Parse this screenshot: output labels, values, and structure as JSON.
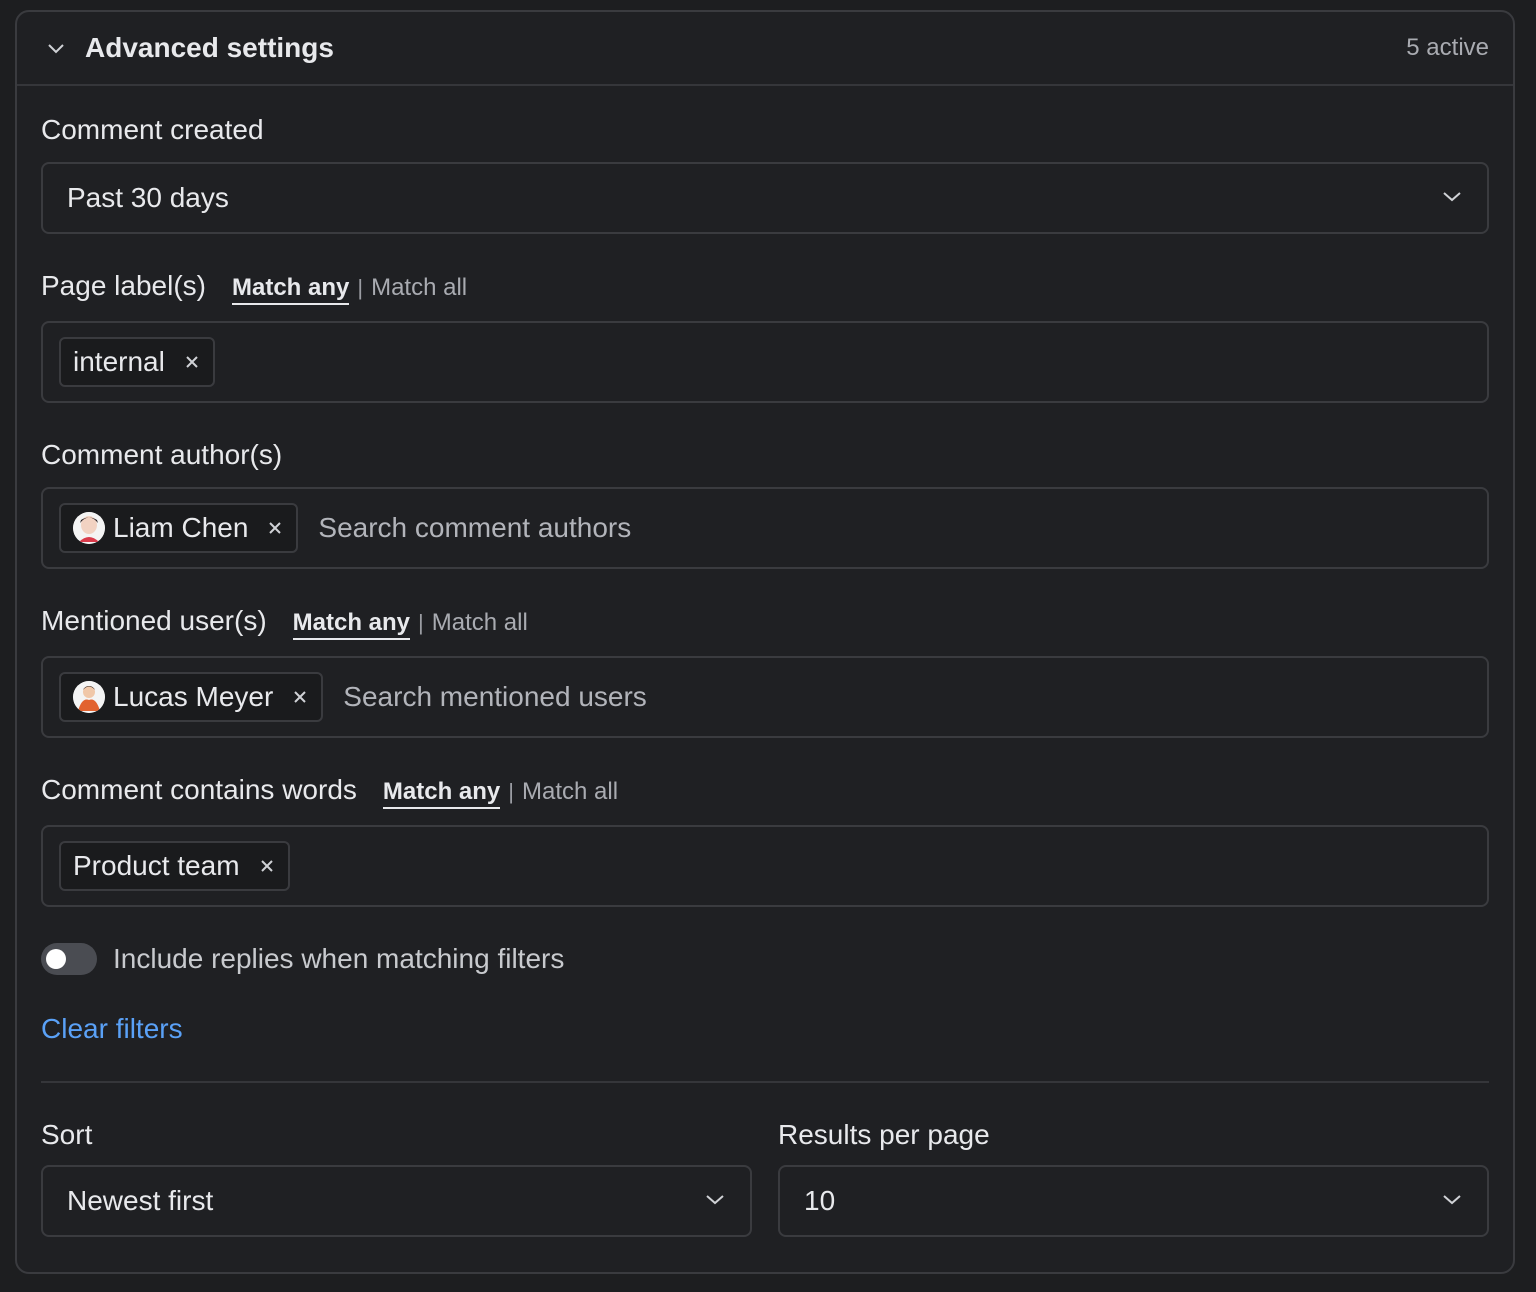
{
  "header": {
    "title": "Advanced settings",
    "active_count": "5 active"
  },
  "comment_created": {
    "label": "Comment created",
    "value": "Past 30 days"
  },
  "page_labels": {
    "label": "Page label(s)",
    "match_any": "Match any",
    "separator": "|",
    "match_all": "Match all",
    "tags": [
      "internal"
    ]
  },
  "comment_authors": {
    "label": "Comment author(s)",
    "tags": [
      "Liam Chen"
    ],
    "placeholder": "Search comment authors"
  },
  "mentioned_users": {
    "label": "Mentioned user(s)",
    "match_any": "Match any",
    "separator": "|",
    "match_all": "Match all",
    "tags": [
      "Lucas Meyer"
    ],
    "placeholder": "Search mentioned users"
  },
  "comment_words": {
    "label": "Comment contains words",
    "match_any": "Match any",
    "separator": "|",
    "match_all": "Match all",
    "tags": [
      "Product team"
    ]
  },
  "include_replies": {
    "label": "Include replies when matching filters",
    "enabled": false
  },
  "clear_filters": "Clear filters",
  "sort": {
    "label": "Sort",
    "value": "Newest first"
  },
  "results_per_page": {
    "label": "Results per page",
    "value": "10"
  },
  "colors": {
    "background": "#1f2023",
    "border": "#3a3b3f",
    "link": "#5aa1f7",
    "text": "#e8e9ec"
  }
}
